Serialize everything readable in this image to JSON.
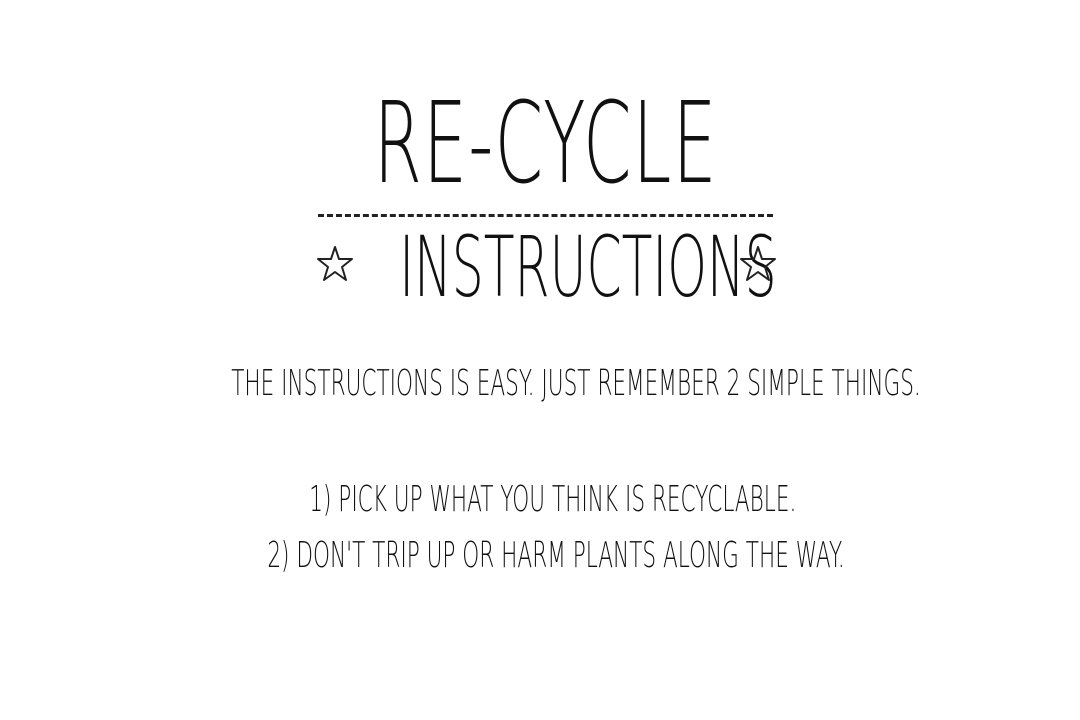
{
  "title": "RE-CYCLE",
  "subtitle": "INSTRUCTIONS",
  "intro": "THE INSTRUCTIONS IS EASY. JUST REMEMBER 2 SIMPLE THINGS.",
  "rules": [
    "1) PICK UP WHAT YOU THINK IS RECYCLABLE.",
    "2) DON'T TRIP UP OR HARM PLANTS ALONG THE WAY."
  ],
  "icons": {
    "left": "star-icon",
    "right": "star-icon"
  },
  "colors": {
    "background": "#ffffff",
    "ink": "#111111"
  }
}
